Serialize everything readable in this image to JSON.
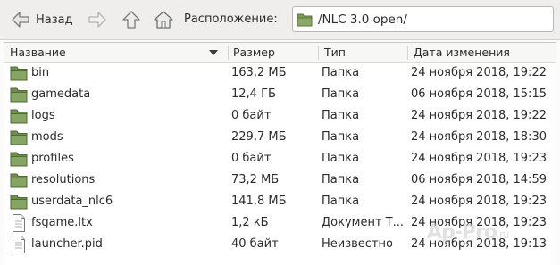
{
  "toolbar": {
    "back_label": "Назад",
    "location_label": "Расположение:",
    "location_path": "/NLC 3.0 open/"
  },
  "columns": {
    "name": "Название",
    "size": "Размер",
    "type": "Тип",
    "date": "Дата изменения"
  },
  "files": [
    {
      "name": "bin",
      "size": "163,2 МБ",
      "type": "Папка",
      "date": "24 ноября 2018, 19:22",
      "icon": "folder-icon"
    },
    {
      "name": "gamedata",
      "size": "12,4 ГБ",
      "type": "Папка",
      "date": "06 ноября 2018, 15:15",
      "icon": "folder-icon"
    },
    {
      "name": "logs",
      "size": "0 байт",
      "type": "Папка",
      "date": "24 ноября 2018, 19:22",
      "icon": "folder-icon"
    },
    {
      "name": "mods",
      "size": "229,7 МБ",
      "type": "Папка",
      "date": "24 ноября 2018, 18:30",
      "icon": "folder-icon"
    },
    {
      "name": "profiles",
      "size": "0 байт",
      "type": "Папка",
      "date": "24 ноября 2018, 19:23",
      "icon": "folder-icon"
    },
    {
      "name": "resolutions",
      "size": "73,2 МБ",
      "type": "Папка",
      "date": "06 ноября 2018, 14:59",
      "icon": "folder-icon"
    },
    {
      "name": "userdata_nlc6",
      "size": "141,8 МБ",
      "type": "Папка",
      "date": "24 ноября 2018, 19:23",
      "icon": "folder-icon"
    },
    {
      "name": "fsgame.ltx",
      "size": "1,2 кБ",
      "type": "Документ Т...",
      "date": "24 ноября 2018, 19:23",
      "icon": "document-icon"
    },
    {
      "name": "launcher.pid",
      "size": "40 байт",
      "type": "Неизвестно",
      "date": "24 ноября 2018, 19:13",
      "icon": "document-icon"
    }
  ],
  "watermark": {
    "main": "Ap-Pro",
    "suffix": ".ru"
  },
  "colors": {
    "folder_fill": "#7d9a5a",
    "folder_dark": "#5f7b40",
    "toolbar_bg": "#efeeec"
  }
}
